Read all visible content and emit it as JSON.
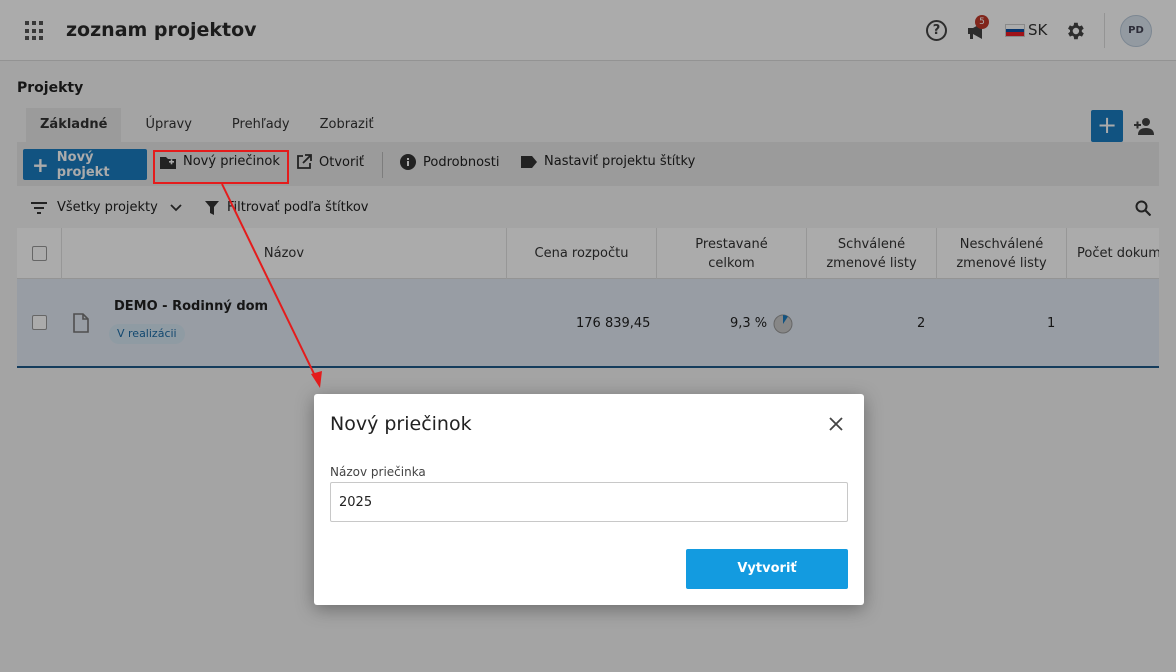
{
  "header": {
    "app_title": "zoznam projektov",
    "notification_count": "5",
    "language": "SK",
    "user_initials": "PD"
  },
  "page": {
    "title": "Projekty"
  },
  "tabs": [
    {
      "label": "Základné",
      "active": true
    },
    {
      "label": "Úpravy",
      "active": false
    },
    {
      "label": "Prehľady",
      "active": false
    },
    {
      "label": "Zobraziť",
      "active": false
    }
  ],
  "toolbar": {
    "new_project": "Nový projekt",
    "new_folder": "Nový priečinok",
    "open": "Otvoriť",
    "details": "Podrobnosti",
    "set_tags": "Nastaviť projektu štítky"
  },
  "filters": {
    "all_projects": "Všetky projekty",
    "filter_by_tags": "Filtrovať podľa štítkov"
  },
  "table": {
    "columns": [
      "Názov",
      "Cena rozpočtu",
      "Prestavané celkom",
      "Schválené zmenové listy",
      "Neschválené zmenové listy",
      "Počet dokumentov"
    ],
    "rows": [
      {
        "name": "DEMO - Rodinný dom",
        "status": "V realizácii",
        "budget": "176 839,45",
        "built_percent": "9,3 %",
        "built_fraction": 0.093,
        "approved": "2",
        "unapproved": "1"
      }
    ]
  },
  "dialog": {
    "title": "Nový priečinok",
    "field_label": "Názov priečinka",
    "field_value": "2025",
    "create_button": "Vytvoriť"
  },
  "colors": {
    "primary": "#1a7cc1",
    "create_button": "#139be0",
    "highlight": "#e41c1c",
    "badge": "#c0392b"
  }
}
